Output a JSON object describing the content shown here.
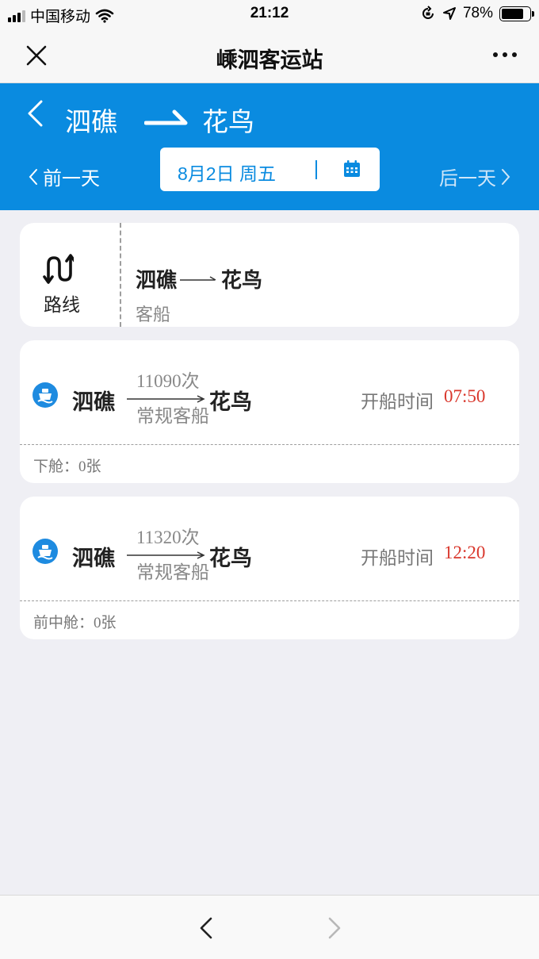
{
  "status_bar": {
    "carrier": "中国移动",
    "time": "21:12",
    "battery": "78%",
    "battery_level": 0.78
  },
  "nav": {
    "title": "嵊泗客运站"
  },
  "header": {
    "from": "泗礁",
    "to": "花鸟",
    "prev_day": "前一天",
    "next_day": "后一天",
    "date": "8月2日 周五"
  },
  "route_card": {
    "icon_label": "路线",
    "from": "泗礁",
    "to": "花鸟",
    "type": "客船"
  },
  "trips": [
    {
      "from": "泗礁",
      "number": "11090次",
      "class": "常规客船",
      "to": "花鸟",
      "depart_label": "开船时间",
      "depart_time": "07:50",
      "cabin_label": "下舱：",
      "cabin_count": "0张"
    },
    {
      "from": "泗礁",
      "number": "11320次",
      "class": "常规客船",
      "to": "花鸟",
      "depart_label": "开船时间",
      "depart_time": "12:20",
      "cabin_label": "前中舱：",
      "cabin_count": "0张"
    }
  ],
  "colors": {
    "accent": "#0a8be0",
    "time_red": "#d9372c",
    "background": "#efeff4"
  }
}
